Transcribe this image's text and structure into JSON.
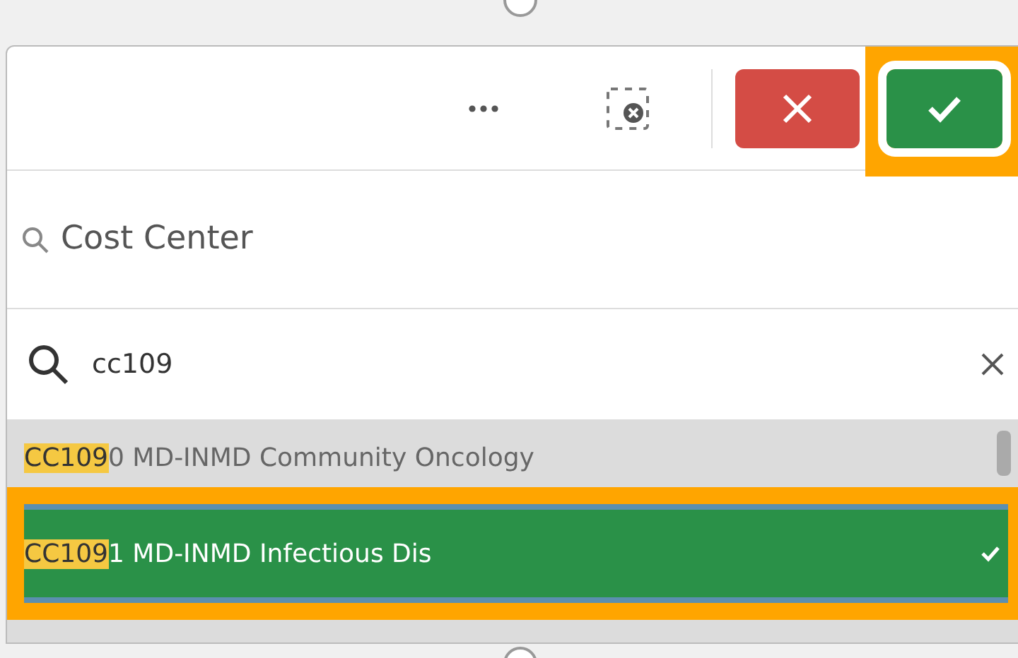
{
  "toolbar": {
    "confirm_highlighted": true
  },
  "field_title": "Cost Center",
  "search": {
    "value": "cc109"
  },
  "items": [
    {
      "match": "CC109",
      "rest": "0 MD-INMD Community Oncology",
      "selected": false
    },
    {
      "match": "CC109",
      "rest": "1 MD-INMD Infectious Dis",
      "selected": true
    }
  ]
}
